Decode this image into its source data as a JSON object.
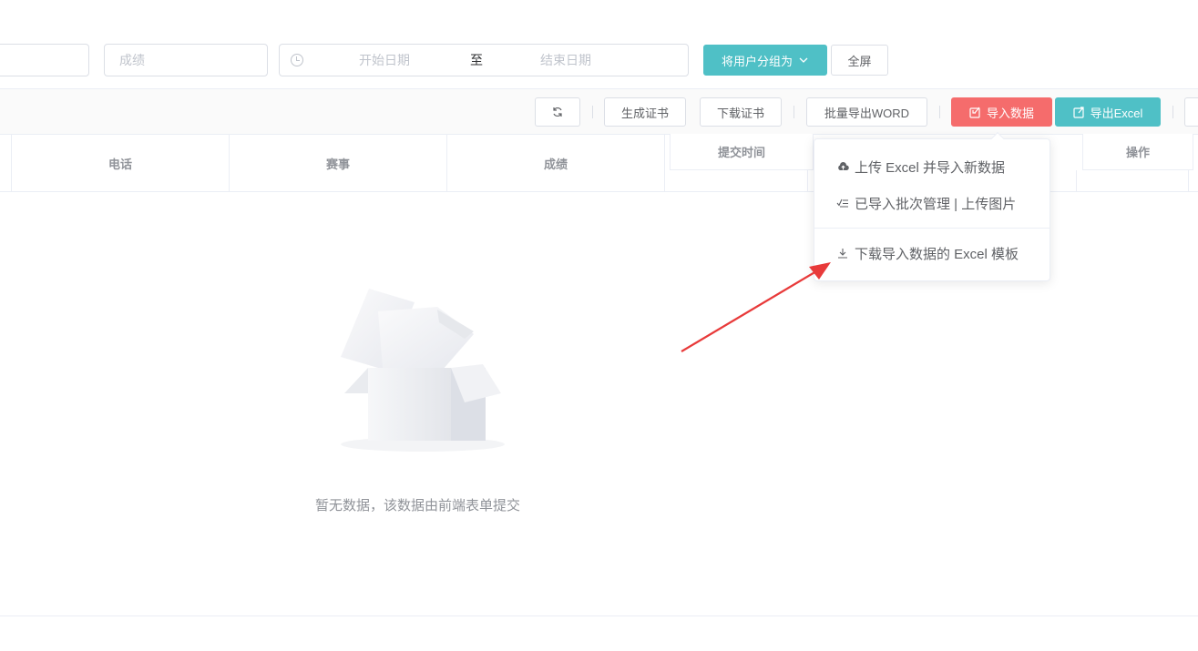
{
  "filters": {
    "score_placeholder": "成绩",
    "date_start_placeholder": "开始日期",
    "date_separator": "至",
    "date_end_placeholder": "结束日期",
    "group_button": "将用户分组为",
    "fullscreen_button": "全屏"
  },
  "toolbar": {
    "generate_cert": "生成证书",
    "download_cert": "下载证书",
    "batch_export_word": "批量导出WORD",
    "import_data": "导入数据",
    "export_excel": "导出Excel"
  },
  "table": {
    "columns": [
      "电话",
      "赛事",
      "成绩",
      "提交时间",
      "操作"
    ],
    "empty_text": "暂无数据，该数据由前端表单提交"
  },
  "import_menu": {
    "items": [
      {
        "icon": "cloud-upload-icon",
        "label": "上传 Excel 并导入新数据"
      },
      {
        "icon": "list-check-icon",
        "label": "已导入批次管理 | 上传图片"
      },
      {
        "icon": "download-icon",
        "label": "下载导入数据的 Excel 模板"
      }
    ]
  },
  "colors": {
    "teal": "#4fc0c6",
    "red": "#f56c6c",
    "annotation_arrow": "#e83a3a"
  }
}
